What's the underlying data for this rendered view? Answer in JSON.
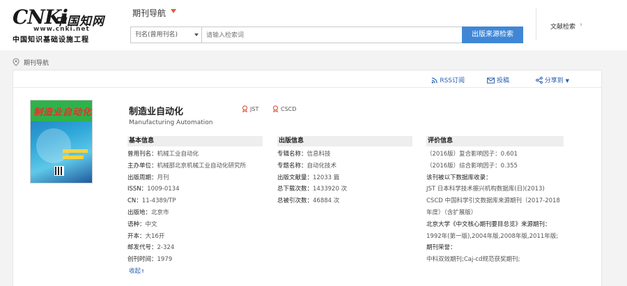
{
  "header": {
    "logo_brand": "CNKi",
    "logo_cn": "中国知网",
    "logo_url": "www.cnki.net",
    "logo_sub": "中国知识基础设施工程",
    "nav_title": "期刊导航",
    "search_type": "刊名(曾用刊名)",
    "search_placeholder": "请输入检索词",
    "search_button": "出版来源检索",
    "lit_search": "文献检索"
  },
  "breadcrumb": "期刊导航",
  "actions": {
    "rss": "RSS订阅",
    "contribute": "投稿",
    "share": "分享到"
  },
  "journal": {
    "cover_title": "制造业自动化",
    "title": "制造业自动化",
    "title_en": "Manufacturing Automation",
    "badges": [
      "JST",
      "CSCD"
    ]
  },
  "basic_info": {
    "heading": "基本信息",
    "rows": [
      {
        "key": "曾用刊名：",
        "value": "机械工业自动化"
      },
      {
        "key": "主办单位：",
        "value": "机械部北京机械工业自动化研究所"
      },
      {
        "key": "出版周期：",
        "value": "月刊"
      },
      {
        "key": "ISSN：",
        "value": "1009-0134"
      },
      {
        "key": "CN：",
        "value": "11-4389/TP"
      },
      {
        "key": "出版地：",
        "value": "北京市"
      },
      {
        "key": "语种：",
        "value": "中文"
      },
      {
        "key": "开本：",
        "value": "大16开"
      },
      {
        "key": "邮发代号：",
        "value": "2-324"
      },
      {
        "key": "创刊时间：",
        "value": "1979"
      }
    ],
    "collapse": "收起"
  },
  "publication_info": {
    "heading": "出版信息",
    "rows": [
      {
        "key": "专辑名称：",
        "value": "信息科技"
      },
      {
        "key": "专题名称：",
        "value": "自动化技术"
      },
      {
        "key": "出版文献量：",
        "value": "12033 篇"
      },
      {
        "key": "总下载次数：",
        "value": "1433920 次"
      },
      {
        "key": "总被引次数：",
        "value": "46884 次"
      }
    ]
  },
  "evaluation_info": {
    "heading": "评价信息",
    "impact_composite": "（2016版）复合影响因子：0.601",
    "impact_comprehensive": "（2016版）综合影响因子：0.355",
    "db_heading": "该刊被以下数据库收录：",
    "db_jst": "JST 日本科学技术振兴机构数据库(日)(2013)",
    "db_cscd_1": "CSCD 中国科学引文数据库来源期刊（2017-2018",
    "db_cscd_2": "年度）（含扩展版）",
    "pku_heading": "北京大学《中文核心期刊要目总览》来源期刊：",
    "pku_years": "1992年(第一版),2004年版,2008年版,2011年版;",
    "honors_heading": "期刊荣誉：",
    "honors": "中科双效期刊;Caj-cd规范获奖期刊;"
  }
}
